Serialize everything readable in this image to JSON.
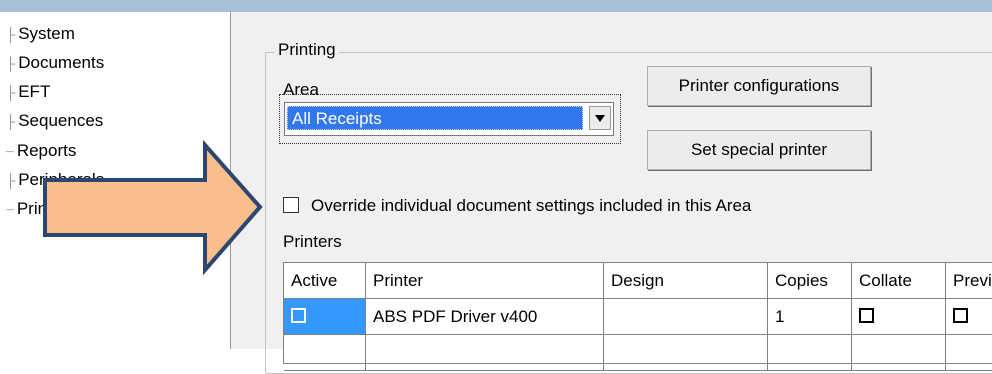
{
  "tree": {
    "items": [
      {
        "label": "System"
      },
      {
        "label": "Documents"
      },
      {
        "label": "EFT"
      },
      {
        "label": "Sequences"
      },
      {
        "label": "Reports"
      },
      {
        "label": "Peripherals"
      },
      {
        "label": "Printing"
      }
    ]
  },
  "printing": {
    "group_title": "Printing",
    "area_label": "Area",
    "area_value": "All Receipts",
    "printer_configurations_label": "Printer configurations",
    "set_special_printer_label": "Set special printer",
    "override_label": "Override individual document settings included in this Area",
    "printers_label": "Printers"
  },
  "grid": {
    "columns": [
      "Active",
      "Printer",
      "Design",
      "Copies",
      "Collate",
      "Previe"
    ],
    "rows": [
      {
        "printer": "ABS PDF Driver v400",
        "design": "",
        "copies": "1"
      }
    ]
  },
  "colors": {
    "selection": "#3377ee",
    "active_cell": "#3399ff",
    "arrow_fill": "#f8be8c",
    "arrow_stroke": "#2b4770"
  },
  "icons": {
    "arrow": "right-arrow-icon"
  }
}
